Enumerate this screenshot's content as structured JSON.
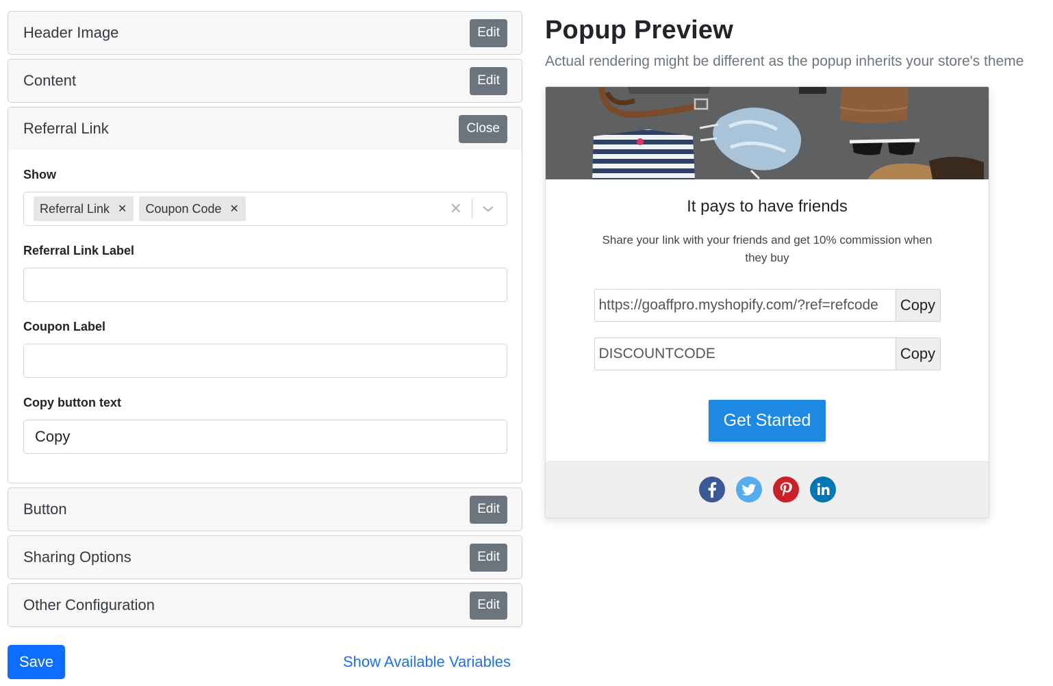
{
  "sections": {
    "header_image": {
      "title": "Header Image",
      "action": "Edit"
    },
    "content": {
      "title": "Content",
      "action": "Edit"
    },
    "referral_link": {
      "title": "Referral Link",
      "action": "Close",
      "show_label": "Show",
      "show_chips": [
        "Referral Link",
        "Coupon Code"
      ],
      "referral_link_label": "Referral Link Label",
      "referral_link_value": "",
      "coupon_label": "Coupon Label",
      "coupon_value": "",
      "copy_button_text_label": "Copy button text",
      "copy_button_text_value": "Copy"
    },
    "button": {
      "title": "Button",
      "action": "Edit"
    },
    "sharing_options": {
      "title": "Sharing Options",
      "action": "Edit"
    },
    "other_configuration": {
      "title": "Other Configuration",
      "action": "Edit"
    }
  },
  "footer": {
    "save_label": "Save",
    "variables_link": "Show Available Variables"
  },
  "preview": {
    "title": "Popup Preview",
    "subtitle": "Actual rendering might be different as the popup inherits your store's theme",
    "popup": {
      "heading": "It pays to have friends",
      "text": "Share your link with your friends and get 10% commission when they buy",
      "referral_url": "https://goaffpro.myshopify.com/?ref=refcode",
      "coupon_code": "DISCOUNTCODE",
      "copy_label": "Copy",
      "cta_label": "Get Started",
      "social_icons": [
        "facebook-icon",
        "twitter-icon",
        "pinterest-icon",
        "linkedin-icon"
      ]
    }
  },
  "colors": {
    "edit_button": "#6c757d",
    "primary": "#0d6efd",
    "cta": "#1e88e5",
    "link": "#1a73e8",
    "facebook": "#3b5998",
    "twitter": "#55acee",
    "pinterest": "#cb2027",
    "linkedin": "#0077b5"
  }
}
